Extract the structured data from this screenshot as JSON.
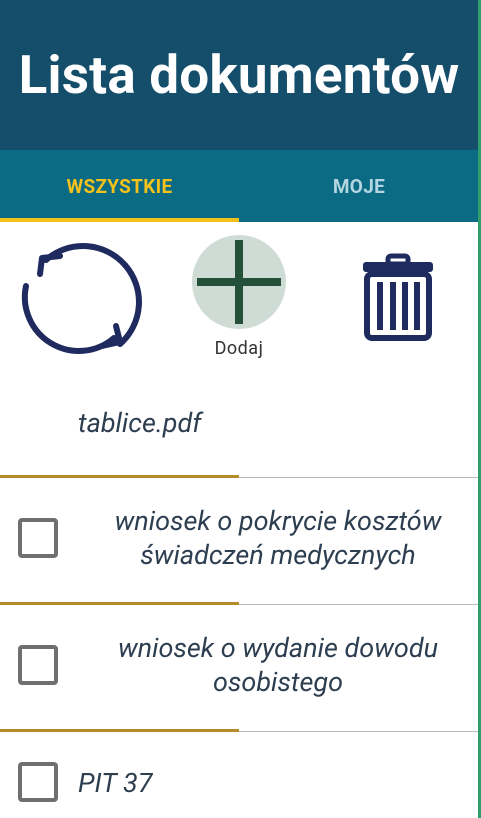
{
  "header": {
    "title": "Lista dokumentów"
  },
  "tabs": [
    {
      "label": "WSZYSTKIE",
      "selected": true
    },
    {
      "label": "MOJE",
      "selected": false
    }
  ],
  "toolbar": {
    "refresh_icon": "refresh-icon",
    "add_icon": "plus-icon",
    "add_label": "Dodaj",
    "delete_icon": "trash-icon"
  },
  "documents": [
    {
      "name": "tablice.pdf",
      "has_checkbox": false
    },
    {
      "name": "wniosek o pokrycie kosztów świadczeń medycznych",
      "has_checkbox": true,
      "checked": false
    },
    {
      "name": "wniosek o wydanie dowodu osobistego",
      "has_checkbox": true,
      "checked": false
    },
    {
      "name": "PIT 37",
      "has_checkbox": true,
      "checked": false
    }
  ],
  "colors": {
    "header_bg": "#144e6b",
    "tabs_bg": "#0b6b85",
    "tab_active": "#f4c21a",
    "tab_inactive": "#b5d6e0",
    "icon_navy": "#1f2a5e",
    "add_circle": "#cfdcd6",
    "add_plus": "#24503a",
    "row_accent": "#b58b2a",
    "text": "#2d3e50"
  }
}
